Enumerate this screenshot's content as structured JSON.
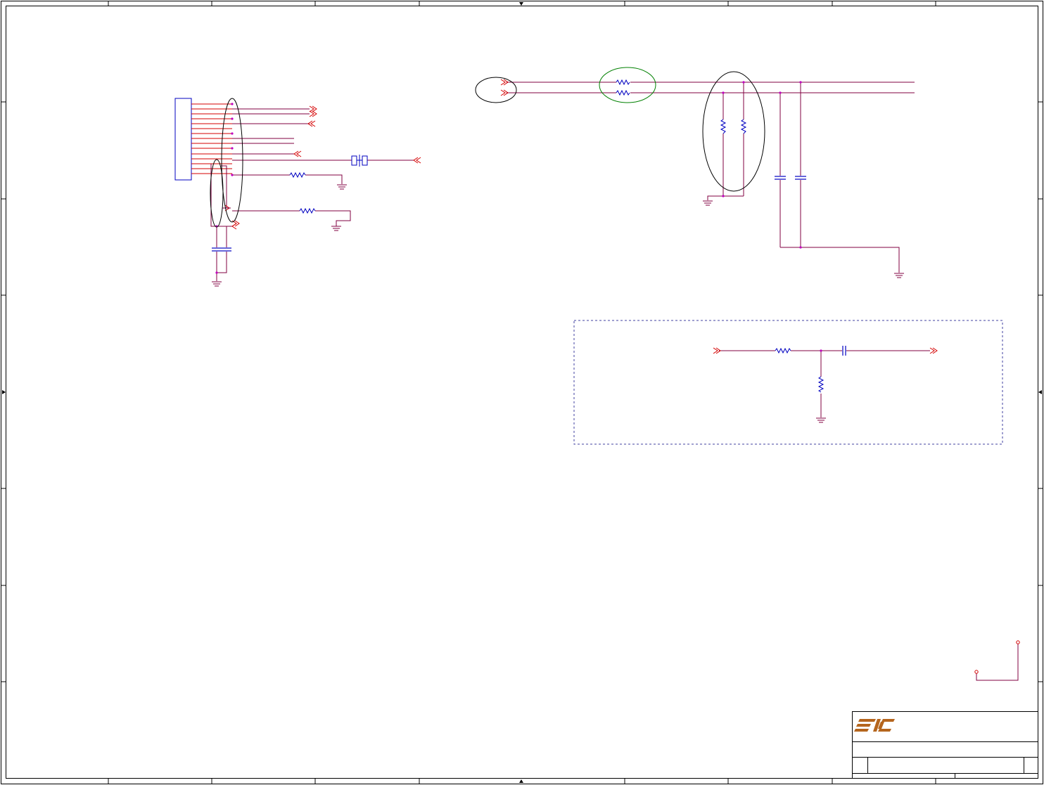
{
  "document": {
    "type": "schematic-sheet",
    "logo": {
      "mark": "FIC",
      "color": "#b5651d"
    }
  },
  "colors": {
    "wire": "#800040",
    "offpage_connector": "#d40000",
    "component": "#0000c0",
    "junction": "#c000c0",
    "highlight_ellipse_black": "#000000",
    "highlight_ellipse_green": "#008000",
    "frame": "#000000",
    "dashed_box": "#4040a0"
  },
  "regions": {
    "connector_block": {
      "description_visible": false
    },
    "filter_network": {
      "description_visible": false
    },
    "dashed_inset": {
      "description_visible": false
    }
  }
}
